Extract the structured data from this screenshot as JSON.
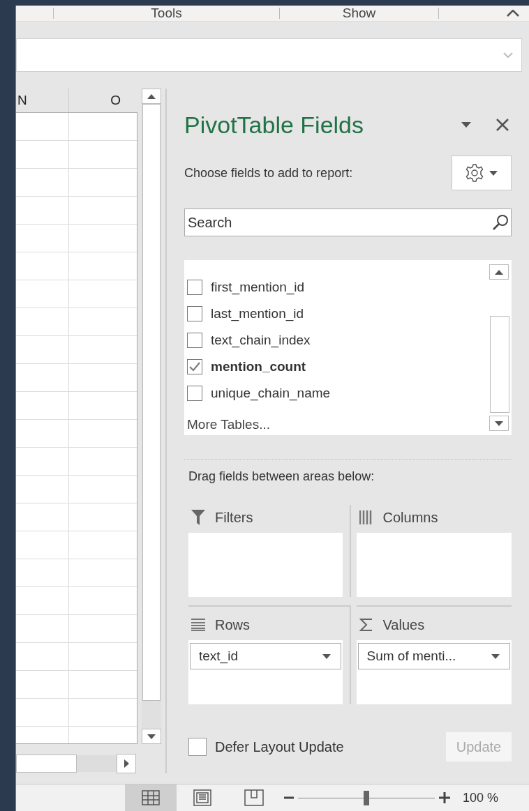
{
  "ribbon": {
    "groups": [
      "Tools",
      "Show"
    ]
  },
  "sheet": {
    "columns": [
      "N",
      "O"
    ]
  },
  "pane": {
    "title": "PivotTable Fields",
    "prompt": "Choose fields to add to report:",
    "search": {
      "placeholder": "Search"
    },
    "fields": [
      {
        "label": "first_mention_id",
        "checked": false
      },
      {
        "label": "last_mention_id",
        "checked": false
      },
      {
        "label": "text_chain_index",
        "checked": false
      },
      {
        "label": "mention_count",
        "checked": true
      },
      {
        "label": "unique_chain_name",
        "checked": false
      }
    ],
    "more_tables": "More Tables...",
    "areas_prompt": "Drag fields between areas below:",
    "areas": [
      {
        "kind": "filters",
        "label": "Filters"
      },
      {
        "kind": "columns",
        "label": "Columns"
      },
      {
        "kind": "rows",
        "label": "Rows",
        "items": [
          "text_id"
        ]
      },
      {
        "kind": "values",
        "label": "Values",
        "items": [
          "Sum of menti..."
        ]
      }
    ],
    "defer": {
      "label": "Defer Layout Update",
      "checked": false
    },
    "update_button": {
      "label": "Update",
      "disabled": true
    }
  },
  "status_bar": {
    "views": [
      {
        "kind": "normal",
        "selected": true
      },
      {
        "kind": "page-layout",
        "selected": false
      },
      {
        "kind": "page-break",
        "selected": false
      }
    ],
    "zoom": {
      "level": 0.5,
      "reading": "100 %"
    }
  }
}
